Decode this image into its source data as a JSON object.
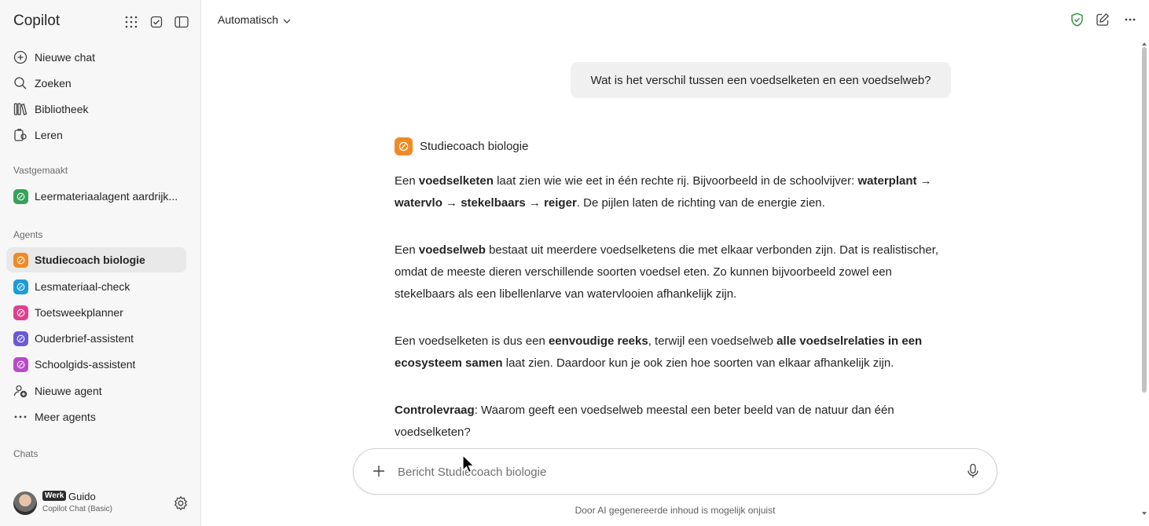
{
  "app": {
    "title": "Copilot"
  },
  "sidebar": {
    "header_icons": [
      "apps-grid-icon",
      "tasks-icon",
      "sidebar-toggle-icon"
    ],
    "nav": [
      {
        "label": "Nieuwe chat",
        "icon": "plus-circle-icon"
      },
      {
        "label": "Zoeken",
        "icon": "search-icon"
      },
      {
        "label": "Bibliotheek",
        "icon": "library-icon"
      },
      {
        "label": "Leren",
        "icon": "learn-icon"
      }
    ],
    "pinned_label": "Vastgemaakt",
    "pinned": [
      {
        "label": "Leermateriaalagent aardrijk...",
        "color": "#36a25a"
      }
    ],
    "agents_label": "Agents",
    "agents": [
      {
        "label": "Studiecoach biologie",
        "color": "#f08a24",
        "active": true
      },
      {
        "label": "Lesmateriaal-check",
        "color": "#1e9bd7"
      },
      {
        "label": "Toetsweekplanner",
        "color": "#e0408b"
      },
      {
        "label": "Ouderbrief-assistent",
        "color": "#6a5ad6"
      },
      {
        "label": "Schoolgids-assistent",
        "color": "#b84bc9"
      }
    ],
    "new_agent_label": "Nieuwe agent",
    "more_agents_label": "Meer agents",
    "chats_label": "Chats",
    "user": {
      "badge": "Werk",
      "name": "Guido",
      "plan": "Copilot Chat (Basic)"
    }
  },
  "topbar": {
    "model": "Automatisch"
  },
  "chat": {
    "user_message": "Wat is het verschil tussen een voedselketen en een voedselweb?",
    "agent_name": "Studiecoach biologie",
    "agent_color": "#f08a24",
    "reply": {
      "p1": [
        {
          "t": "Een "
        },
        {
          "t": "voedselketen",
          "b": true
        },
        {
          "t": " laat zien wie wie eet in één rechte rij. Bijvoorbeeld in de schoolvijver: "
        },
        {
          "t": "waterplant → watervlo → stekelbaars → reiger",
          "b": true
        },
        {
          "t": ". De pijlen laten de richting van de energie zien."
        }
      ],
      "p2": [
        {
          "t": "Een "
        },
        {
          "t": "voedselweb",
          "b": true
        },
        {
          "t": " bestaat uit meerdere voedselketens die met elkaar verbonden zijn. Dat is realistischer, omdat de meeste dieren verschillende soorten voedsel eten. Zo kunnen bijvoorbeeld zowel een stekelbaars als een libellenlarve van watervlooien afhankelijk zijn."
        }
      ],
      "p3": [
        {
          "t": "Een voedselketen is dus een "
        },
        {
          "t": "eenvoudige reeks",
          "b": true
        },
        {
          "t": ", terwijl een voedselweb "
        },
        {
          "t": "alle voedselrelaties in een ecosysteem samen",
          "b": true
        },
        {
          "t": " laat zien. Daardoor kun je ook zien hoe soorten van elkaar afhankelijk zijn."
        }
      ],
      "p4": [
        {
          "t": "Controlevraag",
          "b": true
        },
        {
          "t": ": Waarom geeft een voedselweb meestal een beter beeld van de natuur dan één voedselketen?"
        }
      ]
    }
  },
  "composer": {
    "placeholder": "Bericht Studiecoach biologie"
  },
  "disclaimer": "Door AI gegenereerde inhoud is mogelijk onjuist"
}
